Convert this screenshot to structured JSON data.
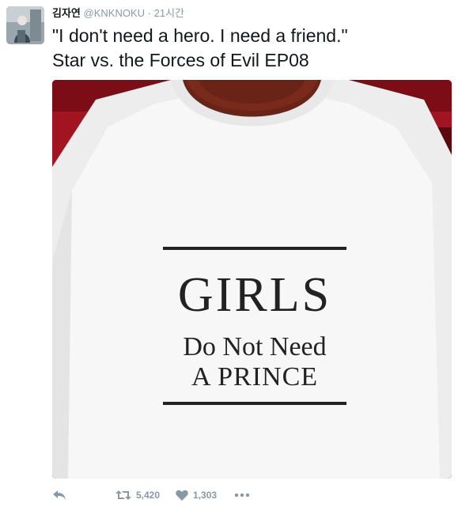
{
  "tweet": {
    "author_name": "김자연",
    "author_handle": "@KNKNOKU",
    "separator": "·",
    "timestamp": "21시간",
    "text_line1": "\"I don't need a hero. I need a friend.\"",
    "text_line2": "Star vs. the Forces of Evil EP08"
  },
  "photo": {
    "shirt_line1": "GIRLS",
    "shirt_line2": "Do Not Need",
    "shirt_line3": "A PRINCE"
  },
  "actions": {
    "retweet_count": "5,420",
    "like_count": "1,303"
  },
  "colors": {
    "text": "#14171a",
    "muted": "#8899a6",
    "seat_red": "#a31522"
  },
  "icons": [
    "reply-icon",
    "retweet-icon",
    "heart-icon",
    "more-icon"
  ]
}
